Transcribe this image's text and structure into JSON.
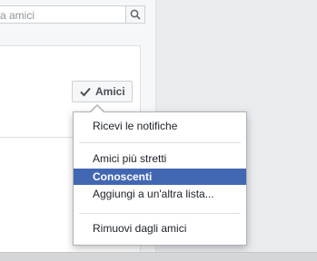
{
  "search": {
    "value": "a amici"
  },
  "icons": {
    "search": "search-icon",
    "check": "checkmark-icon"
  },
  "friend_button": {
    "label": "Amici"
  },
  "menu": {
    "items": [
      {
        "label": "Ricevi le notifiche",
        "selected": false
      },
      {
        "label": "Amici più stretti",
        "selected": false
      },
      {
        "label": "Conoscenti",
        "selected": true
      },
      {
        "label": "Aggiungi a un'altra lista...",
        "selected": false
      },
      {
        "label": "Rimuovi dagli amici",
        "selected": false
      }
    ]
  },
  "colors": {
    "accent": "#4267b2",
    "background": "#e9ebee"
  }
}
